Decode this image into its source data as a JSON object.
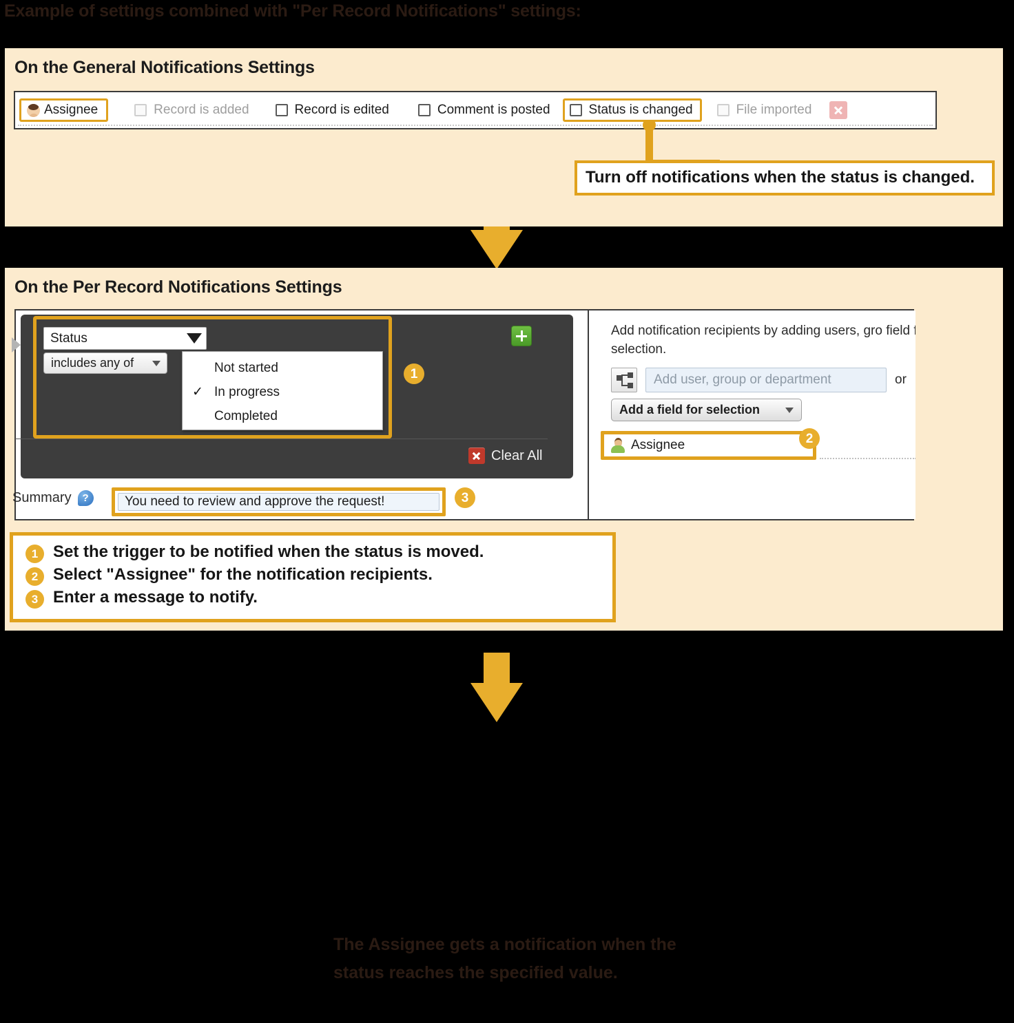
{
  "top_heading": "Example of settings combined with \"Per Record Notifications\" settings:",
  "colors": {
    "page_background": "#000000",
    "panel_background": "#FCEBCE",
    "accent_orange": "#E0A21E",
    "arrow_orange": "#E8AE2D",
    "dark_panel": "#3D3D3D",
    "green_plus": "#5CB032",
    "red_x": "#C0392B",
    "dark_text_on_black": "#2B1B13"
  },
  "general_panel": {
    "title": "On the General Notifications Settings",
    "assignee_chip": {
      "label": "Assignee",
      "icon": "user-avatar-icon",
      "highlighted": true
    },
    "checkbox_items": [
      {
        "label": "Record is added",
        "checked": false,
        "dimmed": true,
        "highlighted": false
      },
      {
        "label": "Record is edited",
        "checked": false,
        "dimmed": false,
        "highlighted": false
      },
      {
        "label": "Comment is posted",
        "checked": false,
        "dimmed": false,
        "highlighted": false
      },
      {
        "label": "Status is changed",
        "checked": false,
        "dimmed": false,
        "highlighted": true
      },
      {
        "label": "File imported",
        "checked": false,
        "dimmed": true,
        "highlighted": false
      }
    ],
    "delete_button_icon": "delete-x-icon",
    "callout": "Turn off notifications when the status is changed."
  },
  "per_record_panel": {
    "title": "On the Per Record Notifications Settings",
    "condition": {
      "field_select": {
        "value": "Status",
        "icon": "chevron-down-icon"
      },
      "operator_select": {
        "value": "includes any of",
        "icon": "chevron-down-icon"
      },
      "dropdown_options": [
        {
          "label": "Not started",
          "checked": false
        },
        {
          "label": "In progress",
          "checked": true
        },
        {
          "label": "Completed",
          "checked": false
        }
      ],
      "add_button_icon": "plus-icon",
      "badge": "1"
    },
    "clear_all": {
      "label": "Clear All",
      "icon": "clear-x-icon"
    },
    "summary": {
      "label": "Summary",
      "help_icon": "help-question-icon",
      "value": "You need to review and approve the request!",
      "badge": "3"
    },
    "recipients": {
      "description": "Add notification recipients by adding users, gro field for selection.",
      "tree_icon": "org-tree-icon",
      "input_placeholder": "Add user, group or department",
      "or_text": "or",
      "add_field_button": {
        "label": "Add a field for selection",
        "icon": "chevron-down-icon"
      },
      "selected_field": {
        "label": "Assignee",
        "icon": "user-avatar-green-icon"
      },
      "badge": "2"
    },
    "instructions": [
      {
        "num": "1",
        "text": "Set the trigger to be notified when the status is moved."
      },
      {
        "num": "2",
        "text": "Select \"Assignee\" for the notification recipients."
      },
      {
        "num": "3",
        "text": "Enter a message to notify."
      }
    ]
  },
  "bottom_note": "The Assignee gets a notification when the status reaches the specified value."
}
